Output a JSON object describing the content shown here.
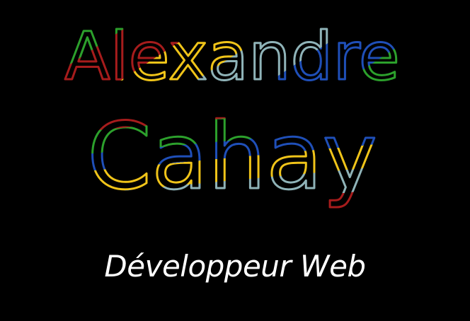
{
  "header": {
    "first_name": "Alexandre",
    "last_name": "Cahay",
    "subtitle": "Développeur Web"
  },
  "colors": {
    "background": "#000000",
    "subtitle": "#ffffff",
    "stroke_palette": [
      "#a61c1c",
      "#f0c419",
      "#2ca02c",
      "#1f4fb8",
      "#8fb3b8"
    ]
  }
}
